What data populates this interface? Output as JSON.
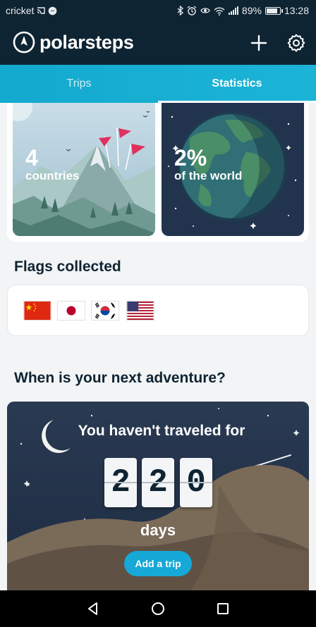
{
  "status_bar": {
    "carrier": "cricket",
    "battery_text": "89%",
    "battery_level": 0.89,
    "time": "13:28",
    "icons": [
      "cast-icon",
      "messenger-icon",
      "bluetooth-icon",
      "alarm-icon",
      "eye-icon",
      "wifi-icon",
      "signal-icon",
      "battery-icon"
    ]
  },
  "header": {
    "brand": "polarsteps",
    "add_icon": "plus-icon",
    "settings_icon": "gear-icon"
  },
  "tabs": [
    {
      "label": "Trips",
      "active": false
    },
    {
      "label": "Statistics",
      "active": true
    }
  ],
  "stats": {
    "countries": {
      "value": "4",
      "label": "countries"
    },
    "world": {
      "value": "2%",
      "label": "of the world"
    }
  },
  "flags_section": {
    "title": "Flags collected",
    "flags": [
      "China",
      "Japan",
      "South Korea",
      "United States"
    ]
  },
  "adventure": {
    "title": "When is your next adventure?",
    "headline": "You haven't traveled for",
    "digits": [
      "2",
      "2",
      "0"
    ],
    "unit": "days",
    "button_label": "Add a trip"
  },
  "colors": {
    "header_bg": "#0f2432",
    "tab_accent": "#1bb4d6",
    "button_blue": "#16a8d6",
    "page_bg": "#f2f4f6"
  },
  "nav_bar": {
    "icons": [
      "back-triangle-icon",
      "home-circle-icon",
      "recents-square-icon"
    ]
  }
}
